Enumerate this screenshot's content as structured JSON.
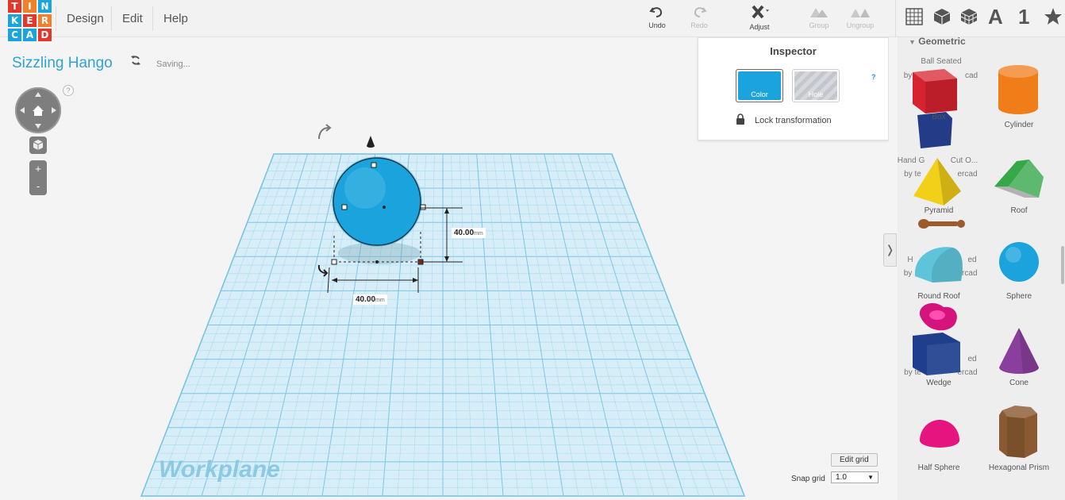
{
  "logo": {
    "letters": [
      "T",
      "I",
      "N",
      "K",
      "E",
      "R",
      "C",
      "A",
      "D"
    ],
    "colors": [
      "#e2382b",
      "#f1802b",
      "#1aa3dc",
      "#1aa3dc",
      "#e2382b",
      "#f1802b",
      "#1aa3dc",
      "#1aa3dc",
      "#e2382b"
    ]
  },
  "menu": {
    "design": "Design",
    "edit": "Edit",
    "help": "Help"
  },
  "toolbar": {
    "undo": "Undo",
    "redo": "Redo",
    "adjust": "Adjust",
    "group": "Group",
    "ungroup": "Ungroup"
  },
  "view_icons": {
    "text_icon": "A",
    "number_icon": "1"
  },
  "document": {
    "title": "Sizzling Hango",
    "status": "Saving..."
  },
  "viewport": {
    "help": "?",
    "zoom_in": "+",
    "zoom_out": "-",
    "workplane_label": "Workplane",
    "dimension_height": "40.00",
    "dimension_width": "40.00",
    "unit": "mm"
  },
  "grid": {
    "edit_button": "Edit grid",
    "snap_label": "Snap grid",
    "snap_value": "1.0"
  },
  "inspector": {
    "title": "Inspector",
    "help": "?",
    "color_label": "Color",
    "hole_label": "Hole",
    "lock_label": "Lock transformation",
    "color_value": "#1aa3dc"
  },
  "panel": {
    "category": "Geometric",
    "shapes": [
      {
        "name": "Box",
        "color": "#d7232f"
      },
      {
        "name": "Cylinder",
        "color": "#f07d18"
      },
      {
        "name": "Pyramid",
        "color": "#f2cf18"
      },
      {
        "name": "Roof",
        "color": "#35a84a"
      },
      {
        "name": "Round Roof",
        "color": "#5fc3d9"
      },
      {
        "name": "Sphere",
        "color": "#1aa3dc"
      },
      {
        "name": "Wedge",
        "color": "#1f3f8e"
      },
      {
        "name": "Cone",
        "color": "#8a3f9e"
      },
      {
        "name": "Half Sphere",
        "color": "#e5147f"
      },
      {
        "name": "Hexagonal Prism",
        "color": "#8b5a33"
      }
    ],
    "ghost_texts": [
      "Ball Seated",
      "by",
      "cad",
      "Hand G",
      "Cut O...",
      "by te",
      "ercad",
      "H",
      "ed",
      "by",
      "ercad",
      "ed",
      "by te",
      "ercad"
    ]
  }
}
